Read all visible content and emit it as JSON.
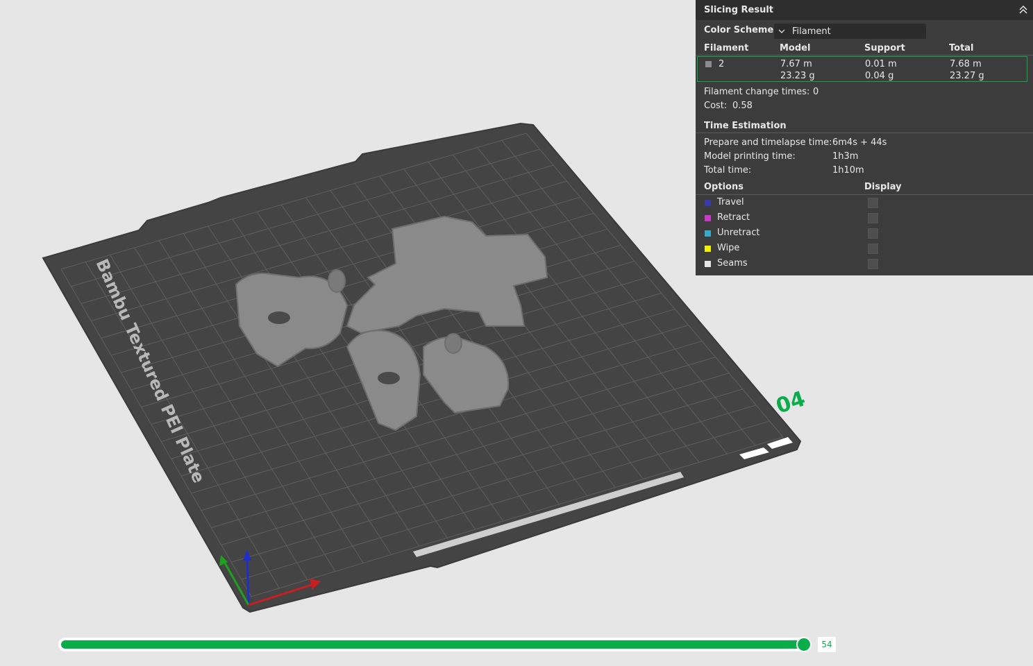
{
  "viewport": {
    "plate_label": "Bambu Textured PEI Plate",
    "plate_number": "04",
    "colors": {
      "background": "#e6e6e6",
      "plate": "#444444",
      "grid": "#5e5e5e",
      "model": "#8a8a8a",
      "accent": "#0aad4a",
      "axis_x": "#c81e1e",
      "axis_y": "#1ea01e",
      "axis_z": "#1e2ec8"
    }
  },
  "slicing_result": {
    "title": "Slicing Result",
    "color_scheme_label": "Color Scheme",
    "color_scheme_value": "Filament",
    "columns": [
      "Filament",
      "Model",
      "Support",
      "Total"
    ],
    "filaments": [
      {
        "id": "2",
        "color": "#8c8c8c",
        "model_length": "7.67 m",
        "model_weight": "23.23 g",
        "support_length": "0.01 m",
        "support_weight": "0.04 g",
        "total_length": "7.68 m",
        "total_weight": "23.27 g"
      }
    ],
    "filament_change_label": "Filament change times:",
    "filament_change_value": "0",
    "cost_label": "Cost:",
    "cost_value": "0.58",
    "time_title": "Time Estimation",
    "prepare_label": "Prepare and timelapse time:",
    "prepare_value": "6m4s + 44s",
    "model_time_label": "Model printing time:",
    "model_time_value": "1h3m",
    "total_time_label": "Total time:",
    "total_time_value": "1h10m",
    "options_header": "Options",
    "display_header": "Display",
    "options": [
      {
        "label": "Travel",
        "color": "#3a3aa8"
      },
      {
        "label": "Retract",
        "color": "#c83ac8"
      },
      {
        "label": "Unretract",
        "color": "#3aa8c8"
      },
      {
        "label": "Wipe",
        "color": "#f0f000"
      },
      {
        "label": "Seams",
        "color": "#e6e6e6"
      }
    ]
  },
  "layer_slider": {
    "value": "54",
    "position_fraction": 1.0
  }
}
